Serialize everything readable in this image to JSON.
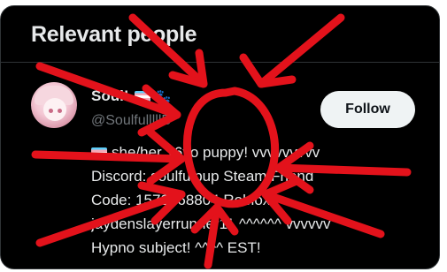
{
  "header": {
    "title": "Relevant people"
  },
  "person": {
    "name": "Soul!",
    "name_flag_icon": "trans-flag-icon",
    "name_paw_icon": "paw-icon",
    "paw_glyph": "🐾",
    "handle": "@SoulfulllllB",
    "follow_label": "Follow",
    "bio_lines": [
      "she/her 16yo puppy! vvvvvvvvv",
      "Discord: soulfulpup Steam Friend",
      "Code: 1572668804 Roblox:",
      "jaydenslayerrunner11 ^^^^^^ vvvvvv",
      "Hypno subject! ^^^^ EST!"
    ]
  },
  "colors": {
    "annotation_red": "#e3121b",
    "card_background": "#000000",
    "follow_button_bg": "#eff3f4"
  }
}
